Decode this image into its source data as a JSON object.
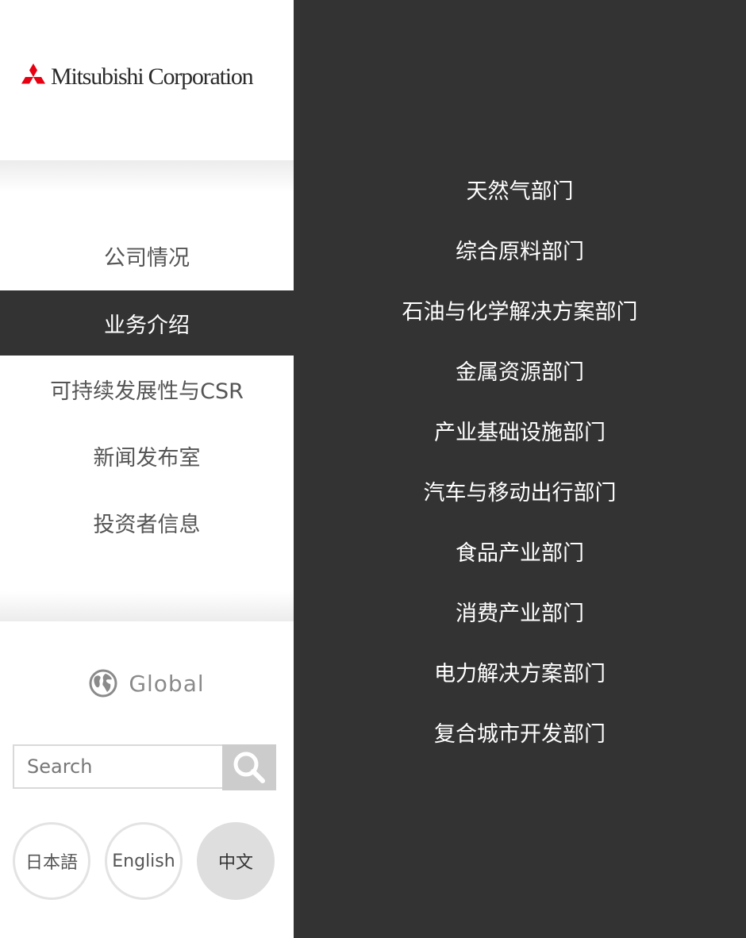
{
  "logo": {
    "text": "Mitsubishi Corporation",
    "mark": "three-diamonds-icon",
    "mark_color": "#e60012"
  },
  "nav": {
    "items": [
      {
        "label": "公司情况",
        "active": false
      },
      {
        "label": "业务介绍",
        "active": true
      },
      {
        "label": "可持续发展性与CSR",
        "active": false
      },
      {
        "label": "新闻发布室",
        "active": false
      },
      {
        "label": "投资者信息",
        "active": false
      }
    ]
  },
  "global": {
    "label": "Global",
    "icon": "globe-icon"
  },
  "search": {
    "placeholder": "Search",
    "value": "",
    "icon": "search-icon"
  },
  "languages": [
    {
      "label": "日本語",
      "current": false
    },
    {
      "label": "English",
      "current": false
    },
    {
      "label": "中文",
      "current": true
    }
  ],
  "departments": [
    "天然气部门",
    "综合原料部门",
    "石油与化学解决方案部门",
    "金属资源部门",
    "产业基础设施部门",
    "汽车与移动出行部门",
    "食品产业部门",
    "消费产业部门",
    "电力解决方案部门",
    "复合城市开发部门"
  ],
  "colors": {
    "panel_dark": "#333333",
    "text_gray": "#555555",
    "accent_red": "#e60012"
  }
}
